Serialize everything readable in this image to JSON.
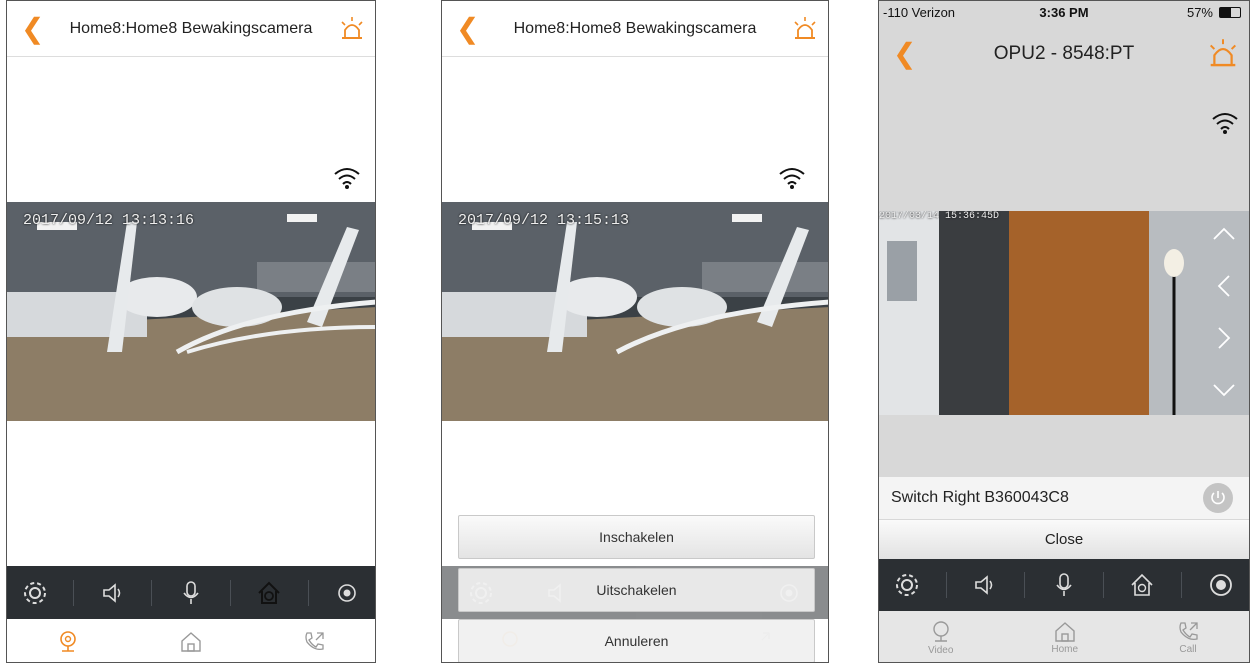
{
  "screen1": {
    "title": "Home8:Home8 Bewakingscamera",
    "timestamp": "2017/09/12 13:13:16",
    "controls": [
      "gear-icon",
      "speaker-icon",
      "mic-icon",
      "home-arm-icon",
      "record-icon"
    ],
    "tabs": [
      "camera-icon",
      "home-icon",
      "call-icon"
    ]
  },
  "screen2": {
    "title": "Home8:Home8 Bewakingscamera",
    "timestamp": "2017/09/12 13:15:13",
    "sheet": {
      "enable_label": "Inschakelen",
      "disable_label": "Uitschakelen",
      "cancel_label": "Annuleren"
    }
  },
  "screen3": {
    "status": {
      "carrier": "-110 Verizon",
      "time": "3:36 PM",
      "battery": "57%"
    },
    "title": "OPU2 - 8548:PT",
    "timestamp": "2017/03/14 15:36:45D",
    "switch_label": "Switch Right B360043C8",
    "close_label": "Close",
    "tabs": {
      "video": "Video",
      "home": "Home",
      "call": "Call"
    }
  },
  "colors": {
    "accent": "#f08a24",
    "bar": "#2b2f33",
    "divider": "#dddddd"
  }
}
